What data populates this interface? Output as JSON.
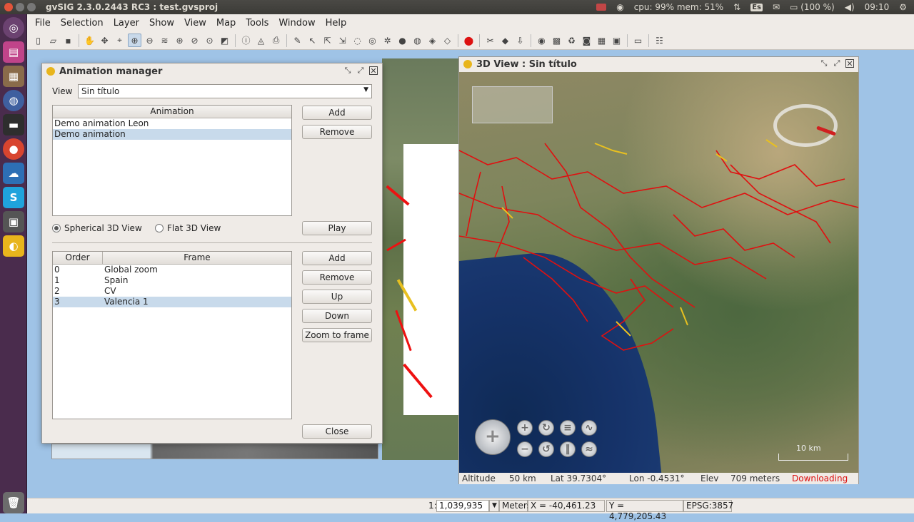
{
  "system_bar": {
    "title": "gvSIG 2.3.0.2443 RC3 : test.gvsproj",
    "cpu_mem": "cpu: 99% mem: 51%",
    "keyboard": "Es",
    "battery": "(100 %)",
    "clock": "09:10"
  },
  "menu": [
    {
      "label": "File"
    },
    {
      "label": "Selection"
    },
    {
      "label": "Layer"
    },
    {
      "label": "Show"
    },
    {
      "label": "View"
    },
    {
      "label": "Map"
    },
    {
      "label": "Tools"
    },
    {
      "label": "Window"
    },
    {
      "label": "Help"
    }
  ],
  "animation_manager": {
    "title": "Animation manager",
    "view_label": "View",
    "view_value": "Sin título",
    "animation_header": "Animation",
    "animations": [
      "Demo animation Leon",
      "Demo animation"
    ],
    "selected_animation": 1,
    "add_label": "Add",
    "remove_label": "Remove",
    "spherical_label": "Spherical 3D View",
    "flat_label": "Flat 3D View",
    "spherical_selected": true,
    "play_label": "Play",
    "frames_headers": {
      "order": "Order",
      "frame": "Frame"
    },
    "frames": [
      {
        "order": "0",
        "frame": "Global zoom"
      },
      {
        "order": "1",
        "frame": "Spain"
      },
      {
        "order": "2",
        "frame": "CV"
      },
      {
        "order": "3",
        "frame": "Valencia 1"
      }
    ],
    "selected_frame": 3,
    "frame_add_label": "Add",
    "frame_remove_label": "Remove",
    "up_label": "Up",
    "down_label": "Down",
    "zoom_label": "Zoom to frame",
    "close_label": "Close"
  },
  "view3d": {
    "title": "3D View : Sin título",
    "scale_label": "10 km",
    "status": {
      "altitude_label": "Altitude",
      "altitude_value": "50 km",
      "lat": "Lat 39.7304°",
      "lon": "Lon -0.4531°",
      "elev_label": "Elev",
      "elev_value": "709 meters",
      "downloading": "Downloading"
    }
  },
  "statusbar": {
    "scale_prefix": "1:",
    "scale_value": "1,039,935",
    "units": "Meters",
    "x": "X = -40,461.23",
    "y": "Y = 4,779,205.43",
    "epsg": "EPSG:3857"
  }
}
